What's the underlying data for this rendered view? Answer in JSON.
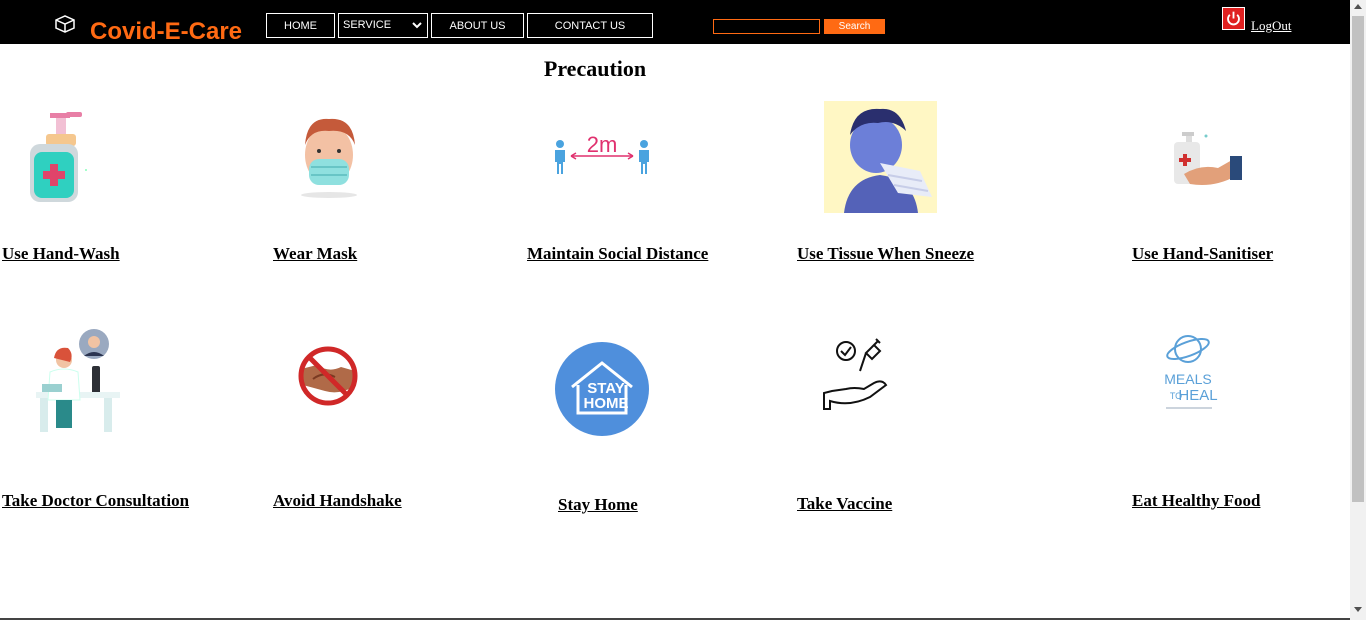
{
  "header": {
    "brand": "Covid-E-Care",
    "nav": {
      "home": "HOME",
      "service": "SERVICE",
      "about": "ABOUT US",
      "contact": "CONTACT US"
    },
    "search": {
      "value": "",
      "button": "Search"
    },
    "logout": "LogOut",
    "colors": {
      "bar": "#000000",
      "accent": "#ff6a13",
      "power": "#e02020"
    }
  },
  "main": {
    "title": "Precaution",
    "items": [
      {
        "label": "Use Hand-Wash",
        "icon": "hand-wash-icon"
      },
      {
        "label": "Wear Mask",
        "icon": "mask-icon"
      },
      {
        "label": "Maintain Social Distance",
        "icon": "social-distance-icon",
        "text": "2m"
      },
      {
        "label": "Use Tissue When Sneeze",
        "icon": "tissue-icon"
      },
      {
        "label": "Use Hand-Sanitiser",
        "icon": "sanitiser-icon"
      },
      {
        "label": "Take Doctor Consultation",
        "icon": "doctor-icon"
      },
      {
        "label": "Avoid Handshake",
        "icon": "no-handshake-icon"
      },
      {
        "label": "Stay Home",
        "icon": "stay-home-icon",
        "text1": "STAY",
        "text2": "HOME"
      },
      {
        "label": "Take Vaccine",
        "icon": "vaccine-icon"
      },
      {
        "label": "Eat Healthy Food",
        "icon": "healthy-food-icon",
        "text1": "MEALS",
        "text2": "TO",
        "text3": "HEAL"
      }
    ]
  }
}
